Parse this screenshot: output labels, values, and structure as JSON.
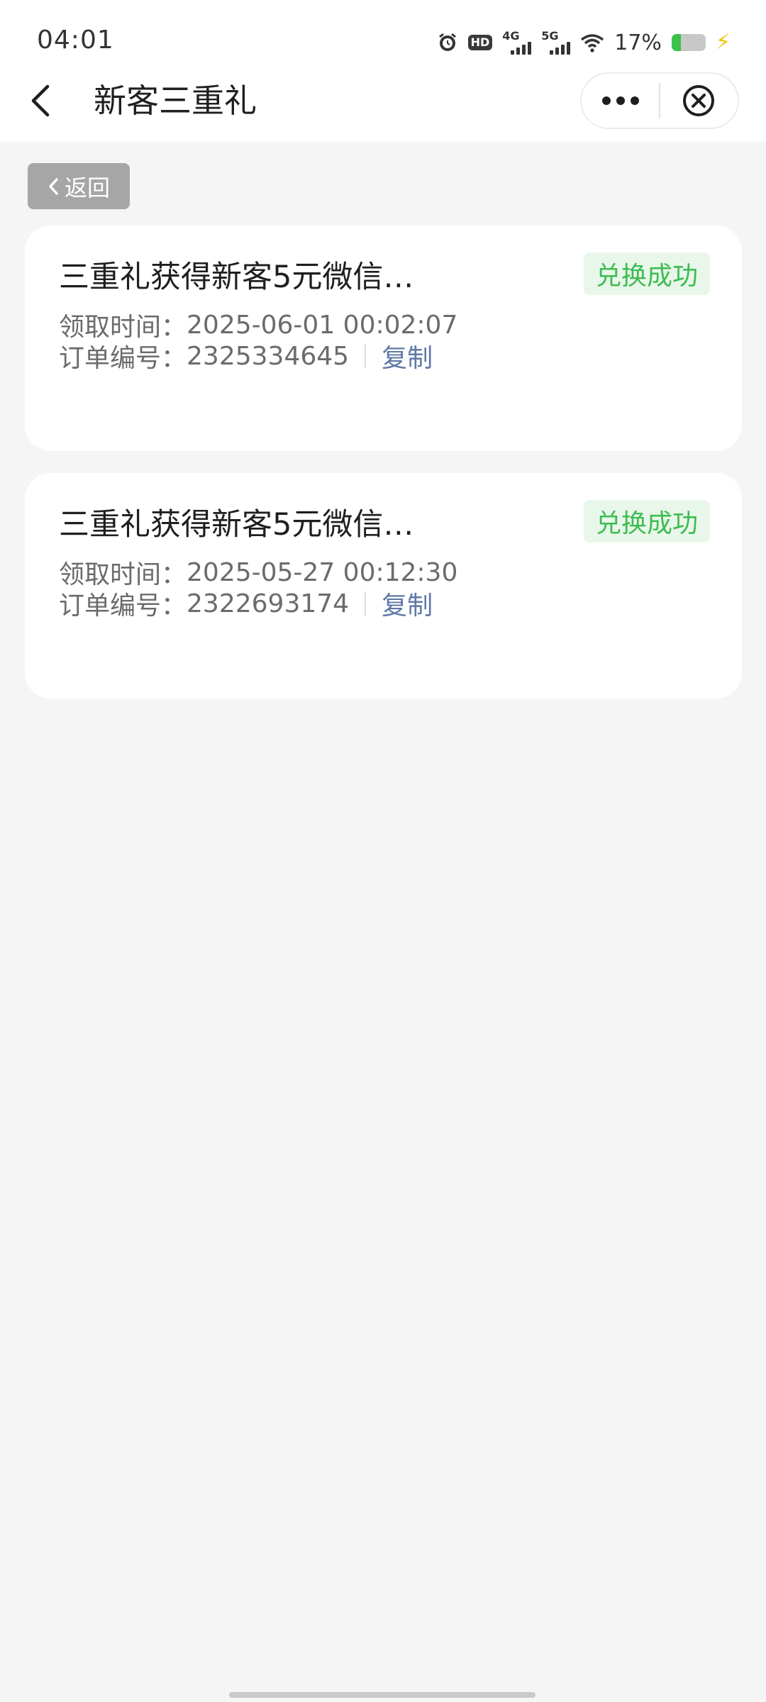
{
  "status_bar": {
    "time": "04:01",
    "hd_label": "HD",
    "net1_label": "4G",
    "net2_label": "5G",
    "battery_percent": "17%",
    "battery_level": 0.17,
    "icons": [
      "alarm-icon",
      "hd-icon",
      "signal-4g-icon",
      "signal-5g-icon",
      "wifi-icon",
      "battery-icon",
      "charging-icon"
    ]
  },
  "header": {
    "title": "新客三重礼",
    "back_icon": "chevron-left-icon",
    "more_icon": "more-dots-icon",
    "close_icon": "close-circle-icon"
  },
  "back_chip": {
    "label": "返回",
    "icon": "chevron-left-icon"
  },
  "orders": [
    {
      "title": "三重礼获得新客5元微信…",
      "status": "兑换成功",
      "time_label": "领取时间：",
      "time": "2025-06-01 00:02:07",
      "order_label": "订单编号：",
      "order_no": "2325334645",
      "copy_label": "复制"
    },
    {
      "title": "三重礼获得新客5元微信…",
      "status": "兑换成功",
      "time_label": "领取时间：",
      "time": "2025-05-27 00:12:30",
      "order_label": "订单编号：",
      "order_no": "2322693174",
      "copy_label": "复制"
    }
  ],
  "colors": {
    "success_text": "#3fbc53",
    "success_bg": "#e9f7ea",
    "link": "#5f78a8",
    "page_bg": "#f5f5f5"
  }
}
